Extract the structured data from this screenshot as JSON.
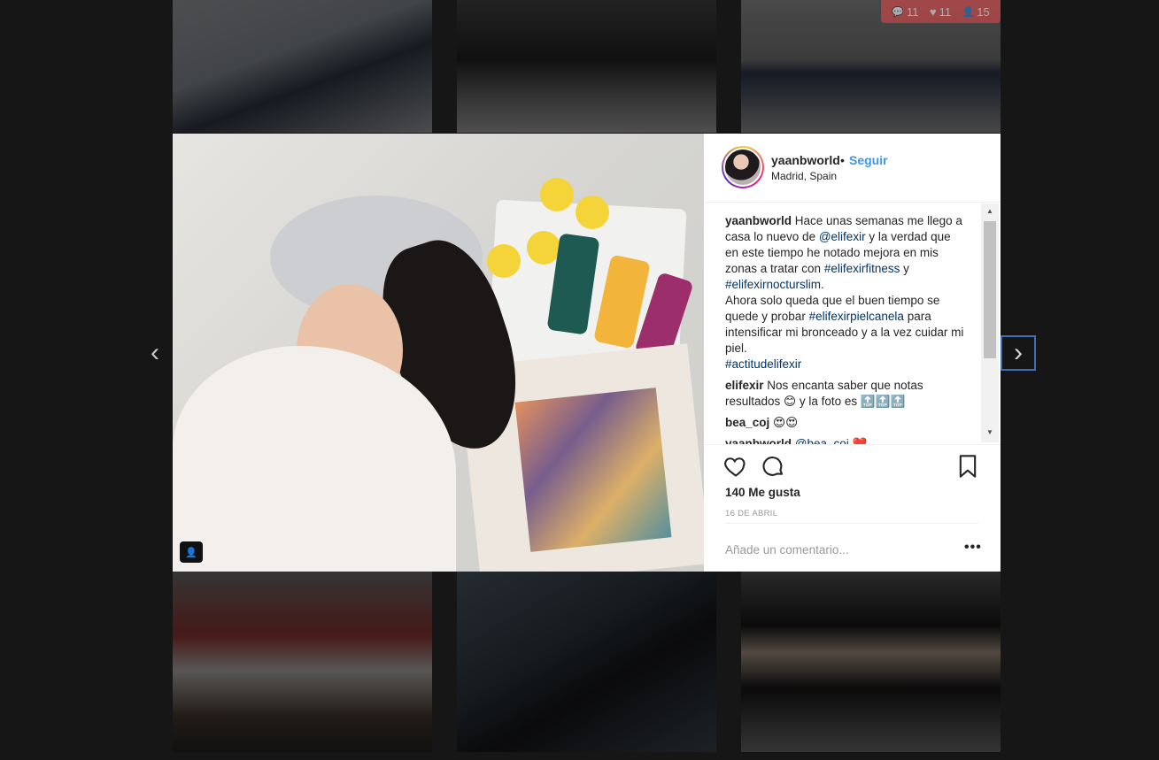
{
  "stats": {
    "comments": "11",
    "likes": "11",
    "tags": "15"
  },
  "post": {
    "username": "yaanbworld",
    "separator": "•",
    "follow_label": "Seguir",
    "location": "Madrid, Spain",
    "likes": "140 Me gusta",
    "date": "16 DE ABRIL",
    "comment_placeholder": "Añade un comentario...",
    "more_label": "•••"
  },
  "comments": {
    "caption_user": "yaanbworld",
    "caption_1": "Hace unas semanas me llego a casa lo nuevo de",
    "mention_1": "@elifexir",
    "caption_2": "y la verdad que en este tiempo he notado mejora en mis zonas a tratar con",
    "tag_1": "#elifexirfitness",
    "caption_3": "y",
    "tag_2": "#elifexirnocturslim",
    "caption_4": ".",
    "caption_5": "Ahora solo queda que el buen tiempo se quede y probar",
    "tag_3": "#elifexirpielcanela",
    "caption_6": "para intensificar mi bronceado y a la vez cuidar mi piel.",
    "tag_4": "#actitudelifexir",
    "c1_user": "elifexir",
    "c1_text": "Nos encanta saber que notas resultados 😊 y la foto es 🔝🔝🔝",
    "c2_user": "bea_coj",
    "c2_text": "😍😍",
    "c3_user": "yaanbworld",
    "c3_mention": "@bea_coj",
    "c3_text": "❤️"
  },
  "icons": {
    "prev": "‹",
    "next": "›",
    "user_tag": "👤",
    "comment_stat": "💬",
    "like_stat": "♥",
    "tag_stat": "👤",
    "scroll_up": "▲",
    "scroll_down": "▼"
  }
}
